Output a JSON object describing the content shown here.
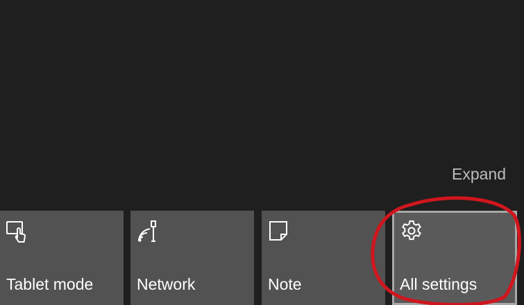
{
  "action_center": {
    "expand_label": "Expand",
    "annotation_color": "#d0161e",
    "tiles": [
      {
        "label": "Tablet mode",
        "icon": "tablet-mode-icon"
      },
      {
        "label": "Network",
        "icon": "network-icon"
      },
      {
        "label": "Note",
        "icon": "note-icon"
      },
      {
        "label": "All settings",
        "icon": "gear-icon"
      }
    ]
  }
}
